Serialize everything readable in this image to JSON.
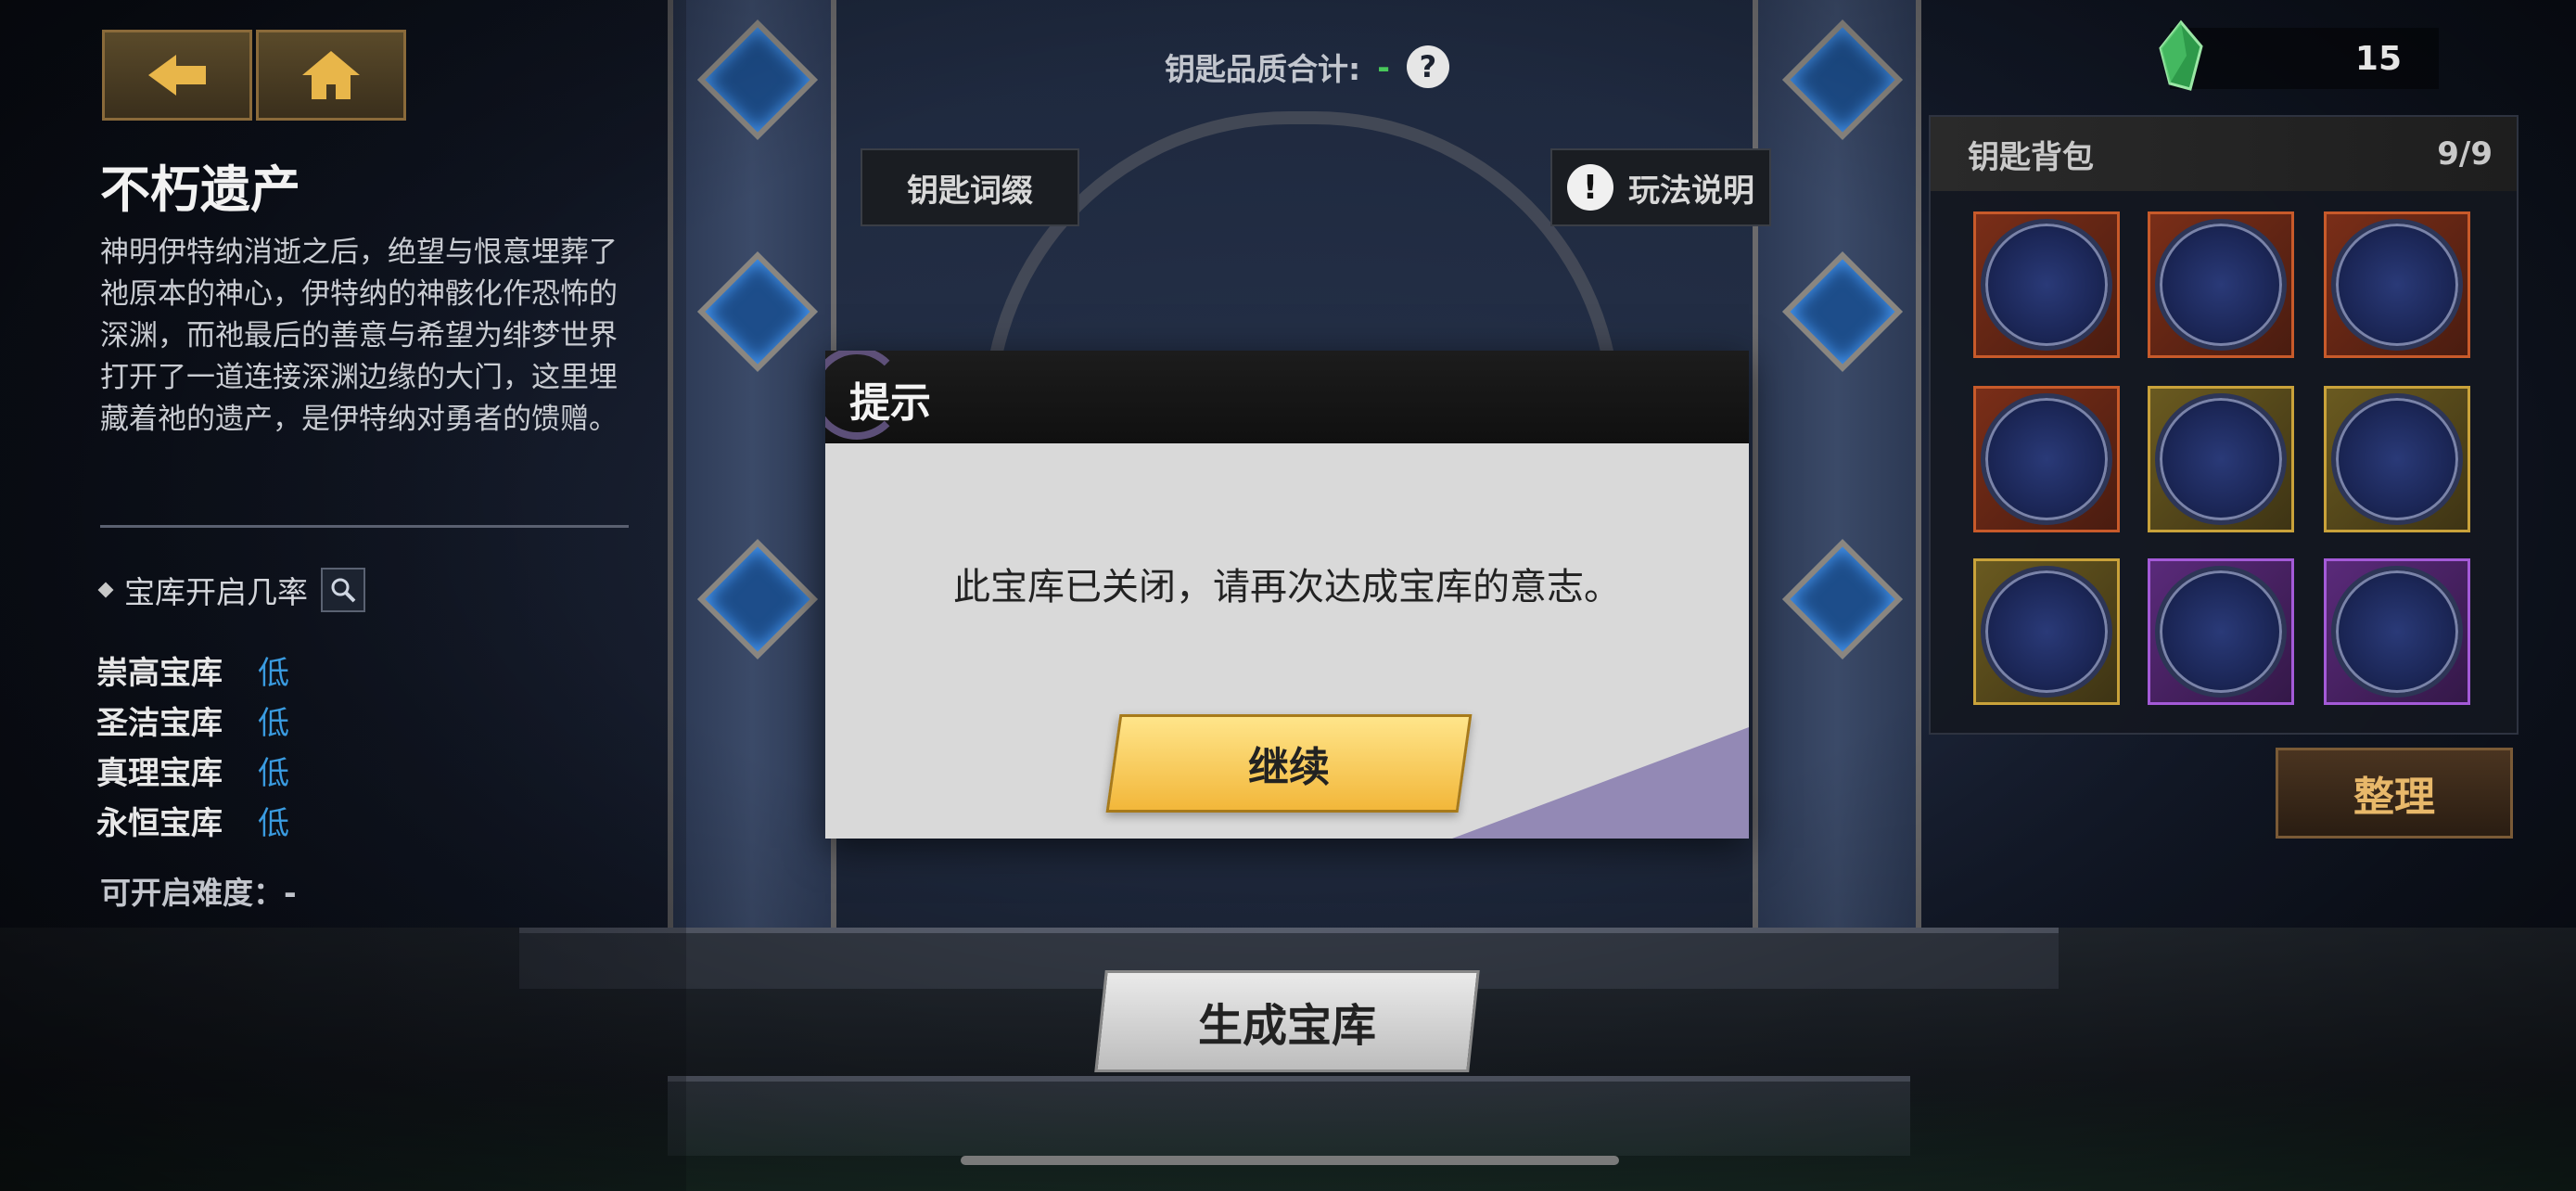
{
  "nav": {
    "back_icon": "back-arrow-icon",
    "home_icon": "home-icon"
  },
  "left_panel": {
    "title": "不朽遗产",
    "description": "神明伊特纳消逝之后，绝望与恨意埋葬了祂原本的神心，伊特纳的神骸化作恐怖的深渊，而祂最后的善意与希望为绯梦世界打开了一道连接深渊边缘的大门，这里埋藏着祂的遗产，是伊特纳对勇者的馈赠。",
    "rate_label": "宝库开启几率",
    "vaults": [
      {
        "name": "崇高宝库",
        "value": "低"
      },
      {
        "name": "圣洁宝库",
        "value": "低"
      },
      {
        "name": "真理宝库",
        "value": "低"
      },
      {
        "name": "永恒宝库",
        "value": "低"
      }
    ],
    "difficulty": "可开启难度：-"
  },
  "top": {
    "quality_label": "钥匙品质合计:",
    "quality_value": "-",
    "key_affix_button": "钥匙词缀",
    "rules_button": "玩法说明"
  },
  "currency": {
    "amount": "15",
    "icon": "green-crystal-icon"
  },
  "bag": {
    "title": "钥匙背包",
    "count": "9/9",
    "slots": [
      "orange",
      "orange",
      "orange",
      "orange",
      "gold",
      "gold",
      "gold",
      "purple",
      "purple"
    ],
    "sort_button": "整理"
  },
  "generate_button": "生成宝库",
  "dialog": {
    "title": "提示",
    "message": "此宝库已关闭，请再次达成宝库的意志。",
    "continue_button": "继续"
  },
  "colors": {
    "rarity_orange": "#c85a2a",
    "rarity_gold": "#c9a23a",
    "rarity_purple": "#a45ad8",
    "accent_blue": "#3a9be0"
  }
}
